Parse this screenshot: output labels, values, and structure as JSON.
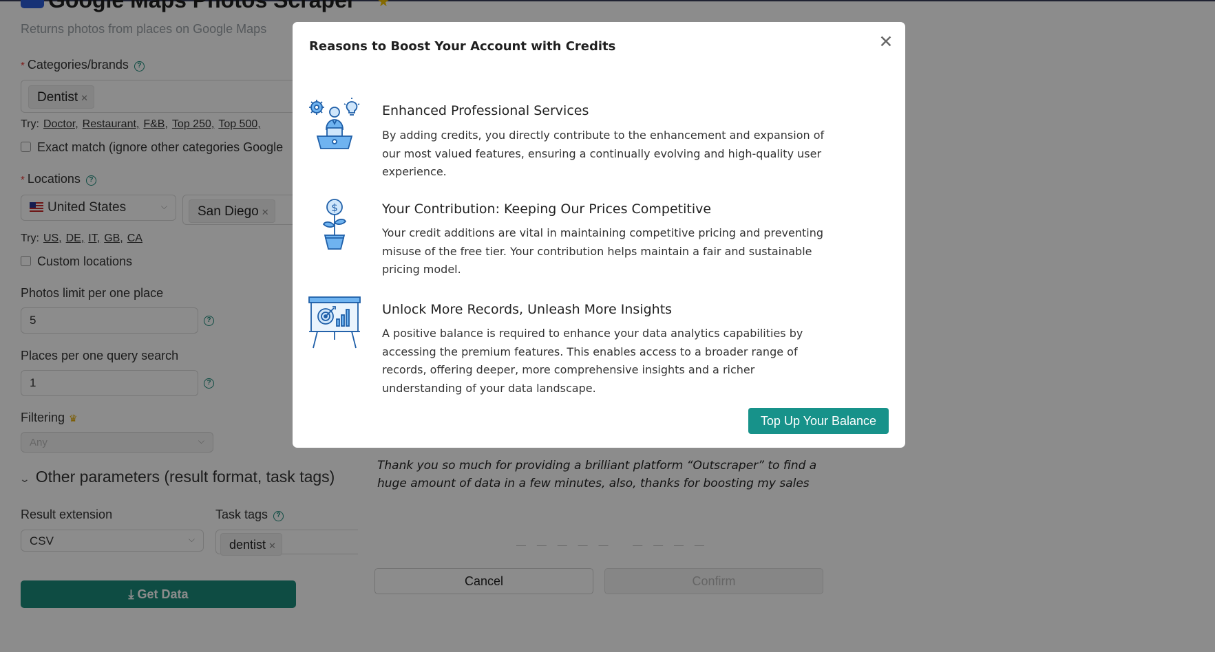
{
  "page": {
    "title": "Google Maps Photos Scraper",
    "subtitle": "Returns photos from places on Google Maps"
  },
  "form": {
    "categories_label": "Categories/brands",
    "categories_tag": "Dentist",
    "categories_try_prefix": "Try:",
    "categories_try": [
      "Doctor,",
      "Restaurant,",
      "F&B,",
      "Top 250,",
      "Top 500,"
    ],
    "exact_match_label": "Exact match (ignore other categories Google",
    "locations_label": "Locations",
    "country_value": "United States",
    "location_tag": "San Diego",
    "locations_try_prefix": "Try:",
    "locations_try": [
      "US,",
      "DE,",
      "IT,",
      "GB,",
      "CA"
    ],
    "custom_locations_label": "Custom locations",
    "photos_limit_label": "Photos limit per one place",
    "photos_limit_value": "5",
    "places_per_query_label": "Places per one query search",
    "places_per_query_value": "1",
    "filtering_label": "Filtering",
    "filtering_value": "Any",
    "other_params_label": "Other parameters (result format, task tags)",
    "result_extension_label": "Result extension",
    "result_extension_value": "CSV",
    "task_tags_label": "Task tags",
    "task_tag": "dentist",
    "get_data_label": "Get Data"
  },
  "review_dialog": {
    "quote": "Thank you so much for providing a brilliant platform “Outscraper” to find a huge amount of data in a few minutes, also, thanks for boosting my sales",
    "cancel_label": "Cancel",
    "confirm_label": "Confirm"
  },
  "modal": {
    "title": "Reasons to Boost Your Account with Credits",
    "features": [
      {
        "icon": "professional-services-icon",
        "title": "Enhanced Professional Services",
        "description": "By adding credits, you directly contribute to the enhancement and expansion of our most valued features, ensuring a continually evolving and high-quality user experience."
      },
      {
        "icon": "money-plant-icon",
        "title": "Your Contribution: Keeping Our Prices Competitive",
        "description": "Your credit additions are vital in maintaining competitive pricing and preventing misuse of the free tier. Your contribution helps maintain a fair and sustainable pricing model."
      },
      {
        "icon": "analytics-board-icon",
        "title": "Unlock More Records, Unleash More Insights",
        "description": "A positive balance is required to enhance your data analytics capabilities by accessing the premium features. This enables access to a broader range of records, offering deeper, more comprehensive insights and a richer understanding of your data landscape."
      }
    ],
    "button_label": "Top Up Your Balance"
  },
  "colors": {
    "accent": "#17928a",
    "icon_blue": "#2e86de"
  }
}
